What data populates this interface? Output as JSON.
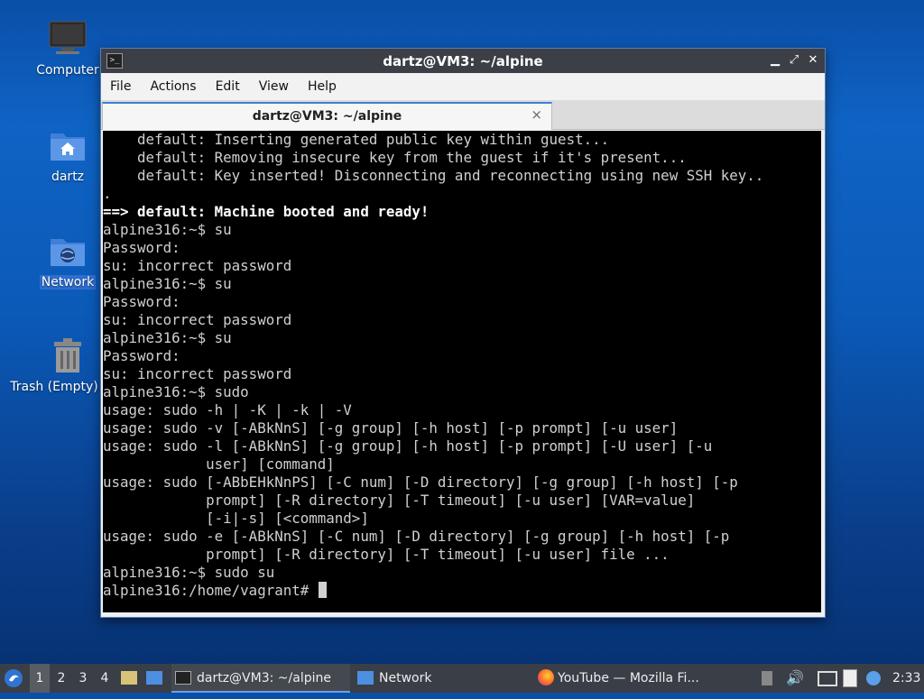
{
  "desktop": {
    "icons": [
      {
        "label": "Computer"
      },
      {
        "label": "dartz"
      },
      {
        "label": "Network"
      },
      {
        "label": "Trash (Empty)"
      }
    ]
  },
  "window": {
    "title": "dartz@VM3: ~/alpine",
    "menu": [
      "File",
      "Actions",
      "Edit",
      "View",
      "Help"
    ],
    "tab_label": "dartz@VM3: ~/alpine",
    "tab_close": "×"
  },
  "terminal": {
    "lines": [
      "    default: Inserting generated public key within guest...",
      "    default: Removing insecure key from the guest if it's present...",
      "    default: Key inserted! Disconnecting and reconnecting using new SSH key..",
      ".",
      "==> default: Machine booted and ready!",
      "alpine316:~$ su",
      "Password:",
      "su: incorrect password",
      "alpine316:~$ su",
      "Password:",
      "su: incorrect password",
      "alpine316:~$ su",
      "Password:",
      "su: incorrect password",
      "alpine316:~$ sudo",
      "usage: sudo -h | -K | -k | -V",
      "usage: sudo -v [-ABkNnS] [-g group] [-h host] [-p prompt] [-u user]",
      "usage: sudo -l [-ABkNnS] [-g group] [-h host] [-p prompt] [-U user] [-u",
      "            user] [command]",
      "usage: sudo [-ABbEHkNnPS] [-C num] [-D directory] [-g group] [-h host] [-p",
      "            prompt] [-R directory] [-T timeout] [-u user] [VAR=value]",
      "            [-i|-s] [<command>]",
      "usage: sudo -e [-ABkNnS] [-C num] [-D directory] [-g group] [-h host] [-p",
      "            prompt] [-R directory] [-T timeout] [-u user] file ...",
      "alpine316:~$ sudo su"
    ],
    "bold_line": 4,
    "prompt": "alpine316:/home/vagrant# "
  },
  "taskbar": {
    "workspaces": [
      "1",
      "2",
      "3",
      "4"
    ],
    "active_workspace": "1",
    "tasks": [
      {
        "label": "dartz@VM3: ~/alpine",
        "icon": "terminal-icon"
      },
      {
        "label": "Network",
        "icon": "folder-icon"
      },
      {
        "label": "YouTube — Mozilla Fi...",
        "icon": "firefox-icon"
      }
    ],
    "clock": "2:33"
  },
  "colors": {
    "terminal_bg": "#000000",
    "terminal_fg": "#d0d0d0",
    "titlebar": "#3c3f45",
    "taskbar": "#3a3e46",
    "accent": "#3d7fd6"
  }
}
